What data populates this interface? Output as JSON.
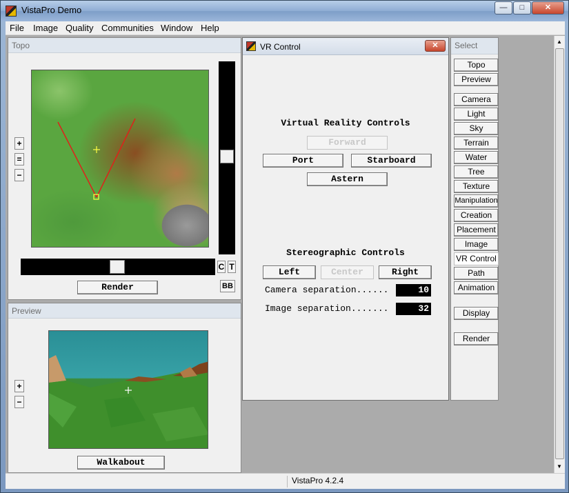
{
  "window": {
    "title": "VistaPro Demo",
    "minimize": "—",
    "maximize": "□",
    "close": "✕"
  },
  "menu": [
    "File",
    "Image",
    "Quality",
    "Communities",
    "Window",
    "Help"
  ],
  "topo": {
    "title": "Topo",
    "zoom_in": "+",
    "zoom_reset": "=",
    "zoom_out": "−",
    "render_label": "Render",
    "c_label": "C",
    "t_label": "T",
    "bb_label": "BB"
  },
  "preview": {
    "title": "Preview",
    "zoom_in": "+",
    "zoom_out": "−",
    "walkabout_label": "Walkabout"
  },
  "vr_control": {
    "title": "VR Control",
    "close": "✕",
    "vr_heading": "Virtual Reality Controls",
    "forward": "Forward",
    "port": "Port",
    "starboard": "Starboard",
    "astern": "Astern",
    "stereo_heading": "Stereographic Controls",
    "left": "Left",
    "center": "Center",
    "right": "Right",
    "camera_sep_label": "Camera separation......",
    "camera_sep_value": "10",
    "image_sep_label": "Image separation.......",
    "image_sep_value": "32"
  },
  "select": {
    "title": "Select",
    "items": [
      "Topo",
      "Preview",
      "Camera",
      "Light",
      "Sky",
      "Terrain",
      "Water",
      "Tree",
      "Texture",
      "Manipulation",
      "Creation",
      "Placement",
      "Image",
      "VR Control",
      "Path",
      "Animation",
      "Display",
      "Render"
    ],
    "active": "VR Control"
  },
  "status": {
    "text": "VistaPro 4.2.4"
  }
}
